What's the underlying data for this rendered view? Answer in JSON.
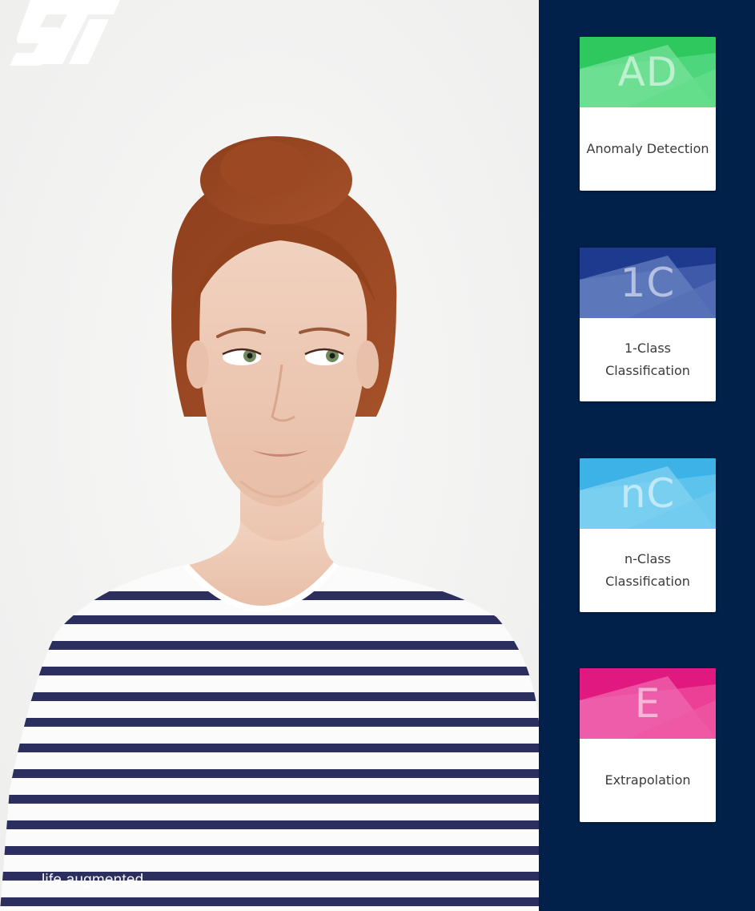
{
  "brand": {
    "logo_icon": "st-logo",
    "logo_text": "ST",
    "tagline": "life.augmented"
  },
  "photo": {
    "subject": "woman-portrait-striped-shirt"
  },
  "cards": [
    {
      "abbr": "AD",
      "label": "Anomaly Detection",
      "color": "#4dd67b",
      "color_light": "#7be39c",
      "color_dark": "#2ec85f"
    },
    {
      "abbr": "1C",
      "label": "1-Class Classification",
      "color": "#3f5aa8",
      "color_light": "#6a83c2",
      "color_dark": "#1d3a8f"
    },
    {
      "abbr": "nC",
      "label": "n-Class Classification",
      "color": "#5bc3ec",
      "color_light": "#86d4f2",
      "color_dark": "#3db2e6"
    },
    {
      "abbr": "E",
      "label": "Extrapolation",
      "color": "#ec3f96",
      "color_light": "#f06bb0",
      "color_dark": "#e0187f"
    }
  ]
}
